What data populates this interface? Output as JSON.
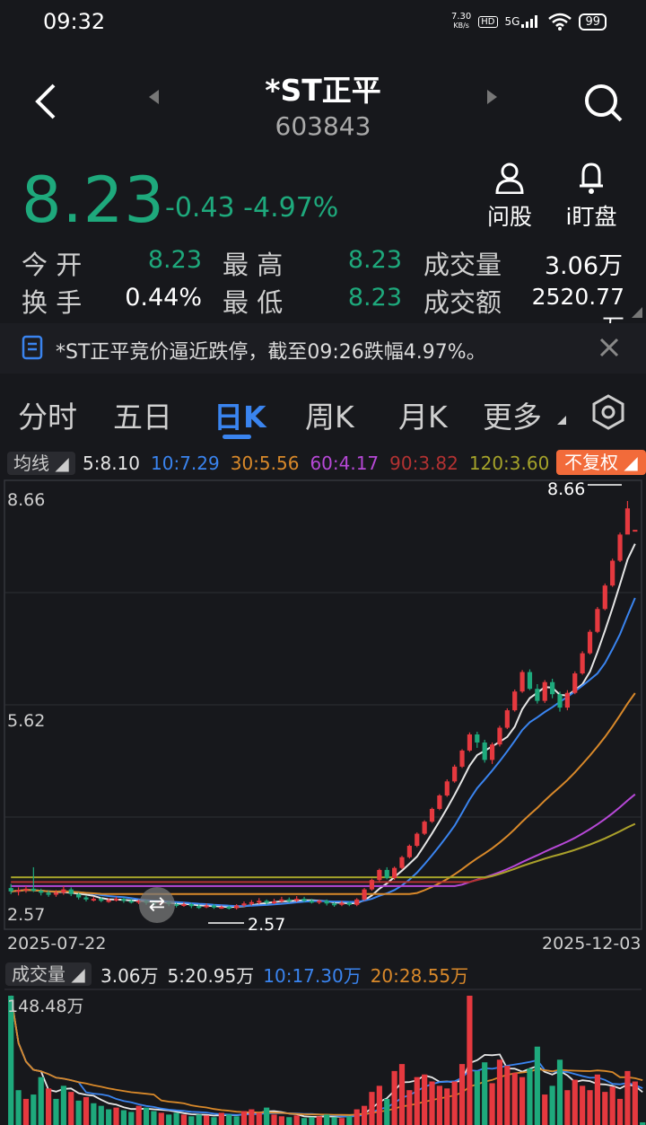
{
  "status_bar": {
    "time": "09:32",
    "net_speed": "7.30",
    "net_unit": "KB/s",
    "hd": "HD",
    "signal": "5G",
    "battery": "99"
  },
  "header": {
    "name": "*ST正平",
    "code": "603843"
  },
  "actions": {
    "ask": "问股",
    "watch": "i盯盘"
  },
  "quote": {
    "price": "8.23",
    "change": "-0.43",
    "change_pct": "-4.97%",
    "open_label": "今 开",
    "open": "8.23",
    "high_label": "最 高",
    "high": "8.23",
    "vol_label": "成交量",
    "vol": "3.06万",
    "turnover_label": "换 手",
    "turnover": "0.44%",
    "low_label": "最 低",
    "low": "8.23",
    "amount_label": "成交额",
    "amount": "2520.77万"
  },
  "notice": {
    "text": "*ST正平竞价逼近跌停，截至09:26跌幅4.97%。"
  },
  "tabs": [
    "分时",
    "五日",
    "日K",
    "周K",
    "月K",
    "更多"
  ],
  "active_tab": "日K",
  "ma_legend": {
    "label": "均线",
    "items": [
      {
        "text": "5:8.10",
        "color": "#e6e6e6"
      },
      {
        "text": "10:7.29",
        "color": "#3a84ef"
      },
      {
        "text": "30:5.56",
        "color": "#d9892a"
      },
      {
        "text": "60:4.17",
        "color": "#b648d6"
      },
      {
        "text": "90:3.82",
        "color": "#b33232"
      },
      {
        "text": "120:3.60",
        "color": "#a5a32a"
      }
    ],
    "adjust": "不复权"
  },
  "kline": {
    "y_max_label": "8.66",
    "y_mid_label": "5.62",
    "y_min_label": "2.57",
    "max_marker": "8.66",
    "min_marker": "2.57",
    "date_start": "2025-07-22",
    "date_end": "2025-12-03"
  },
  "volume_legend": {
    "label": "成交量",
    "items": [
      {
        "text": "3.06万",
        "color": "#e6e6e6"
      },
      {
        "text": "5:20.95万",
        "color": "#e6e6e6"
      },
      {
        "text": "10:17.30万",
        "color": "#3a84ef"
      },
      {
        "text": "20:28.55万",
        "color": "#d9892a"
      }
    ],
    "y_max_label": "148.48万"
  },
  "chart_data": [
    {
      "type": "candlestick",
      "ylim": [
        2.57,
        8.66
      ],
      "x_range": [
        "2025-07-22",
        "2025-12-03"
      ],
      "series": [
        {
          "name": "5",
          "color": "#e6e6e6"
        },
        {
          "name": "10",
          "color": "#3a84ef"
        },
        {
          "name": "30",
          "color": "#d9892a"
        },
        {
          "name": "60",
          "color": "#b648d6"
        },
        {
          "name": "90",
          "color": "#b33232"
        },
        {
          "name": "120",
          "color": "#a5a32a"
        }
      ],
      "candles": [
        [
          2.89,
          2.84,
          2.95,
          2.8
        ],
        [
          2.84,
          2.86,
          2.9,
          2.78
        ],
        [
          2.86,
          2.88,
          2.92,
          2.82
        ],
        [
          2.88,
          2.85,
          3.2,
          2.83
        ],
        [
          2.85,
          2.82,
          2.88,
          2.78
        ],
        [
          2.82,
          2.79,
          2.85,
          2.76
        ],
        [
          2.79,
          2.82,
          2.86,
          2.76
        ],
        [
          2.82,
          2.87,
          2.92,
          2.79
        ],
        [
          2.87,
          2.8,
          2.9,
          2.77
        ],
        [
          2.8,
          2.75,
          2.82,
          2.72
        ],
        [
          2.75,
          2.72,
          2.78,
          2.69
        ],
        [
          2.72,
          2.73,
          2.76,
          2.69
        ],
        [
          2.73,
          2.7,
          2.76,
          2.68
        ],
        [
          2.7,
          2.71,
          2.74,
          2.67
        ],
        [
          2.71,
          2.73,
          2.76,
          2.69
        ],
        [
          2.73,
          2.7,
          2.75,
          2.67
        ],
        [
          2.7,
          2.68,
          2.73,
          2.66
        ],
        [
          2.68,
          2.7,
          2.72,
          2.65
        ],
        [
          2.7,
          2.67,
          2.72,
          2.64
        ],
        [
          2.67,
          2.66,
          2.69,
          2.63
        ],
        [
          2.66,
          2.68,
          2.71,
          2.63
        ],
        [
          2.68,
          2.65,
          2.7,
          2.62
        ],
        [
          2.65,
          2.63,
          2.67,
          2.6
        ],
        [
          2.63,
          2.65,
          2.68,
          2.61
        ],
        [
          2.65,
          2.62,
          2.67,
          2.59
        ],
        [
          2.62,
          2.61,
          2.65,
          2.58
        ],
        [
          2.61,
          2.63,
          2.66,
          2.59
        ],
        [
          2.63,
          2.6,
          2.65,
          2.58
        ],
        [
          2.6,
          2.61,
          2.63,
          2.58
        ],
        [
          2.61,
          2.59,
          2.63,
          2.57
        ],
        [
          2.59,
          2.63,
          2.65,
          2.57
        ],
        [
          2.63,
          2.66,
          2.69,
          2.61
        ],
        [
          2.66,
          2.68,
          2.71,
          2.63
        ],
        [
          2.68,
          2.7,
          2.74,
          2.65
        ],
        [
          2.7,
          2.67,
          2.72,
          2.64
        ],
        [
          2.67,
          2.69,
          2.73,
          2.65
        ],
        [
          2.69,
          2.72,
          2.76,
          2.67
        ],
        [
          2.72,
          2.7,
          2.75,
          2.67
        ],
        [
          2.7,
          2.73,
          2.77,
          2.68
        ],
        [
          2.73,
          2.7,
          2.76,
          2.68
        ],
        [
          2.7,
          2.68,
          2.73,
          2.66
        ],
        [
          2.68,
          2.7,
          2.72,
          2.65
        ],
        [
          2.7,
          2.66,
          2.72,
          2.63
        ],
        [
          2.66,
          2.64,
          2.68,
          2.61
        ],
        [
          2.64,
          2.67,
          2.7,
          2.62
        ],
        [
          2.67,
          2.64,
          2.69,
          2.62
        ],
        [
          2.64,
          2.72,
          2.74,
          2.62
        ],
        [
          2.72,
          2.87,
          2.89,
          2.7
        ],
        [
          2.87,
          3.01,
          3.03,
          2.85
        ],
        [
          3.01,
          3.16,
          3.18,
          2.98
        ],
        [
          3.16,
          3.04,
          3.2,
          3.02
        ],
        [
          3.04,
          3.19,
          3.21,
          3.01
        ],
        [
          3.19,
          3.35,
          3.37,
          3.17
        ],
        [
          3.35,
          3.52,
          3.54,
          3.33
        ],
        [
          3.52,
          3.7,
          3.72,
          3.5
        ],
        [
          3.7,
          3.88,
          3.9,
          3.68
        ],
        [
          3.88,
          4.07,
          4.09,
          3.86
        ],
        [
          4.07,
          4.27,
          4.29,
          4.05
        ],
        [
          4.27,
          4.48,
          4.51,
          4.25
        ],
        [
          4.48,
          4.7,
          4.73,
          4.46
        ],
        [
          4.7,
          4.94,
          4.96,
          4.68
        ],
        [
          4.94,
          5.18,
          5.21,
          4.92
        ],
        [
          5.18,
          5.06,
          5.22,
          4.98
        ],
        [
          5.06,
          4.8,
          5.1,
          4.76
        ],
        [
          4.8,
          5.03,
          5.06,
          4.74
        ],
        [
          5.03,
          5.28,
          5.31,
          5.0
        ],
        [
          5.28,
          5.54,
          5.57,
          5.26
        ],
        [
          5.54,
          5.82,
          5.85,
          5.52
        ],
        [
          5.82,
          6.11,
          6.14,
          5.8
        ],
        [
          6.11,
          5.86,
          6.15,
          5.84
        ],
        [
          5.86,
          5.68,
          5.93,
          5.64
        ],
        [
          5.68,
          5.96,
          5.99,
          5.65
        ],
        [
          5.96,
          5.78,
          6.01,
          5.72
        ],
        [
          5.78,
          5.58,
          5.82,
          5.52
        ],
        [
          5.58,
          5.8,
          5.84,
          5.54
        ],
        [
          5.8,
          6.09,
          6.12,
          5.78
        ],
        [
          6.09,
          6.39,
          6.42,
          6.07
        ],
        [
          6.39,
          6.71,
          6.74,
          6.37
        ],
        [
          6.71,
          7.05,
          7.08,
          6.69
        ],
        [
          7.05,
          7.4,
          7.43,
          7.03
        ],
        [
          7.4,
          7.77,
          7.8,
          7.38
        ],
        [
          7.77,
          8.16,
          8.19,
          7.75
        ],
        [
          8.16,
          8.55,
          8.66,
          8.4
        ],
        [
          8.23,
          8.23,
          8.23,
          8.23
        ]
      ]
    },
    {
      "type": "bar",
      "title": "成交量",
      "ylim": [
        0,
        148.48
      ],
      "unit": "万",
      "values": [
        148.48,
        40,
        30,
        35,
        55,
        42,
        30,
        45,
        38,
        28,
        32,
        25,
        22,
        18,
        20,
        17,
        15,
        22,
        20,
        16,
        14,
        12,
        14,
        12,
        10,
        12,
        11,
        9,
        14,
        12,
        10,
        16,
        18,
        14,
        20,
        12,
        10,
        9,
        11,
        8,
        9,
        10,
        12,
        9,
        8,
        10,
        18,
        22,
        38,
        45,
        30,
        62,
        70,
        40,
        55,
        58,
        50,
        45,
        42,
        50,
        70,
        148.48,
        62,
        72,
        48,
        75,
        68,
        60,
        55,
        65,
        90,
        35,
        45,
        75,
        40,
        52,
        45,
        40,
        58,
        38,
        44,
        30,
        62,
        50,
        3.06
      ],
      "up": [
        false,
        false,
        true,
        false,
        false,
        true,
        false,
        false,
        true,
        false,
        true,
        false,
        false,
        false,
        true,
        false,
        false,
        true,
        false,
        false,
        true,
        false,
        false,
        true,
        false,
        false,
        true,
        false,
        true,
        false,
        false,
        true,
        true,
        true,
        false,
        true,
        true,
        false,
        true,
        false,
        false,
        true,
        false,
        false,
        true,
        false,
        true,
        true,
        true,
        true,
        false,
        true,
        true,
        true,
        true,
        true,
        true,
        true,
        true,
        true,
        true,
        true,
        false,
        false,
        true,
        true,
        true,
        true,
        true,
        false,
        false,
        true,
        false,
        false,
        true,
        true,
        true,
        true,
        true,
        true,
        true,
        true,
        true,
        true,
        false
      ]
    }
  ]
}
